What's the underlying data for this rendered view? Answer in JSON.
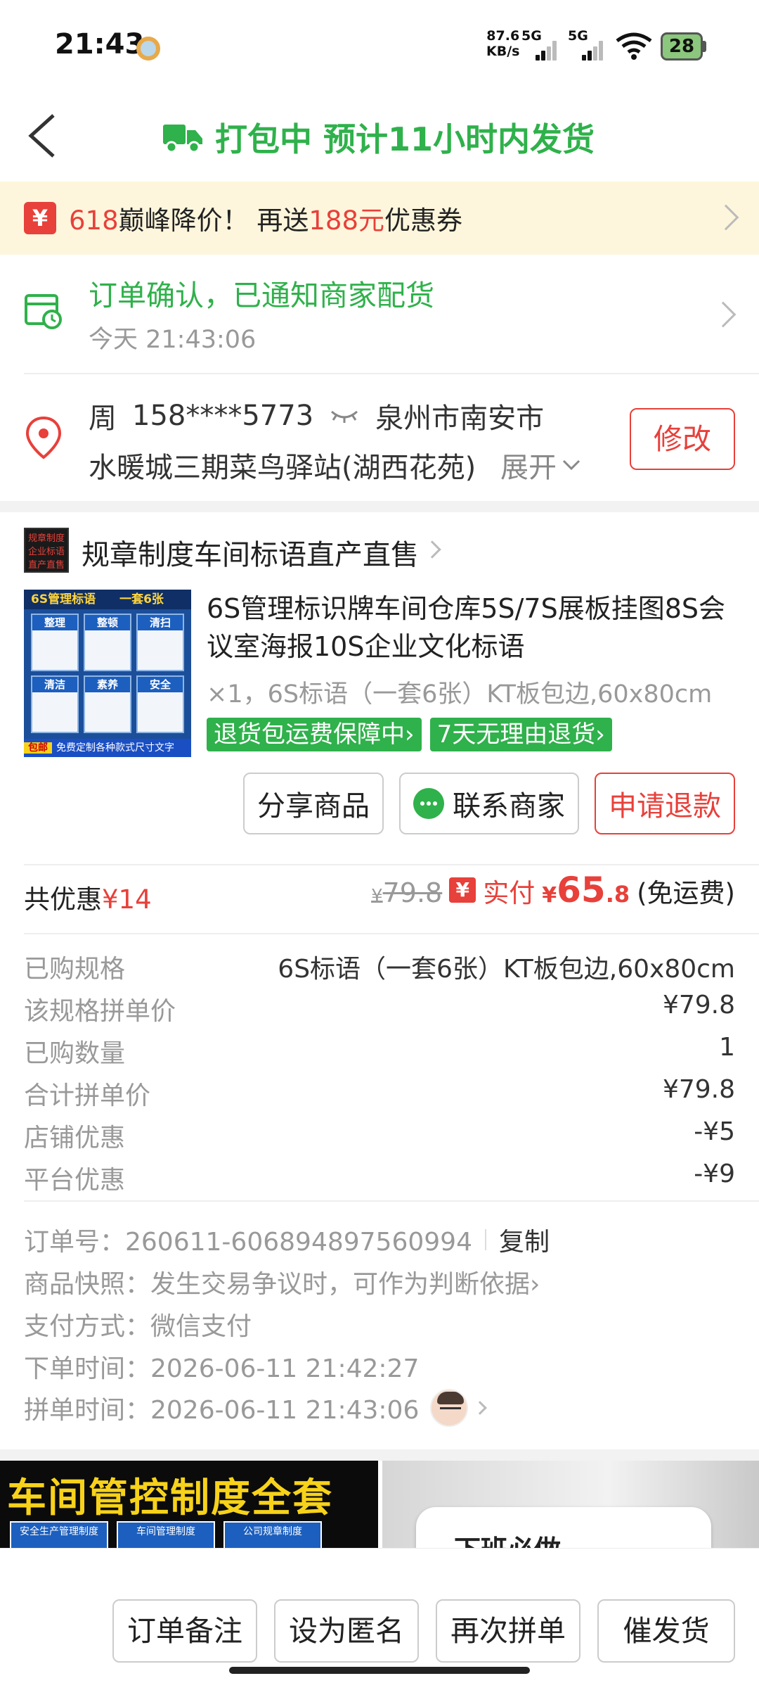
{
  "status_bar": {
    "time": "21:43",
    "net_speed_value": "87.6",
    "net_speed_unit": "KB/s",
    "sim1": "5G",
    "sim2": "5G",
    "battery": "28"
  },
  "header": {
    "title": "打包中 预计11小时内发货",
    "icon": "truck-icon"
  },
  "promo": {
    "badge": "¥",
    "prefix": "618",
    "middle": "巅峰降价！ 再送",
    "amount": "188元",
    "suffix": "优惠券"
  },
  "order_status": {
    "title": "订单确认，已通知商家配货",
    "time": "今天 21:43:06"
  },
  "address": {
    "name": "周",
    "phone": "158****5773",
    "region": "泉州市南安市",
    "detail": "水暖城三期菜鸟驿站(湖西花苑)",
    "expand": "展开",
    "edit_label": "修改"
  },
  "shop": {
    "name": "规章制度车间标语直产直售",
    "logo_text": "规章制度 企业标语 直产直售"
  },
  "product": {
    "title": "6S管理标识牌车间仓库5S/7S展板挂图8S会议室海报10S企业文化标语",
    "spec": "×1，6S标语（一套6张）KT板包边,60x80cm",
    "image_header": "6S管理标语　　一套6张",
    "image_cells": [
      "整理",
      "整顿",
      "清扫",
      "清洁",
      "素养",
      "安全"
    ],
    "image_badge": "包邮",
    "image_footer": "免费定制各种款式尺寸文字",
    "tags": [
      "退货包运费保障中›",
      "7天无理由退货›"
    ]
  },
  "actions": {
    "share": "分享商品",
    "contact": "联系商家",
    "refund": "申请退款"
  },
  "totals": {
    "discount_label": "共优惠",
    "discount_value": "¥14",
    "original_currency": "¥",
    "original_price": "79.8",
    "paid_badge": "¥",
    "paid_label": "实付",
    "paid_currency": "¥",
    "paid_int": "65",
    "paid_dec": ".8",
    "shipping": "(免运费)"
  },
  "details": [
    {
      "key": "已购规格",
      "value": "6S标语（一套6张）KT板包边,60x80cm"
    },
    {
      "key": "该规格拼单价",
      "value": "¥79.8"
    },
    {
      "key": "已购数量",
      "value": "1"
    },
    {
      "key": "合计拼单价",
      "value": "¥79.8"
    },
    {
      "key": "店铺优惠",
      "value": "-¥5"
    },
    {
      "key": "平台优惠",
      "value": "-¥9"
    }
  ],
  "order_info": {
    "order_no": "订单号：260611-606894897560994",
    "copy": "复制",
    "snapshot": "商品快照：发生交易争议时，可作为判断依据›",
    "payment": "支付方式：微信支付",
    "order_time": "下单时间：2026-06-11 21:42:27",
    "group_time": "拼单时间：2026-06-11 21:43:06"
  },
  "recommendations": {
    "item1_title": "车间管控制度全套",
    "item1_cards": [
      "安全生产管理制度",
      "车间管理制度",
      "公司规章制度"
    ],
    "item2_sign": "下班必做"
  },
  "bottom_bar": {
    "note": "订单备注",
    "anonymous": "设为匿名",
    "reorder": "再次拼单",
    "urge": "催发货"
  },
  "colors": {
    "green": "#2fb14b",
    "red": "#e8403a",
    "promo_bg": "#fdf6dc"
  }
}
